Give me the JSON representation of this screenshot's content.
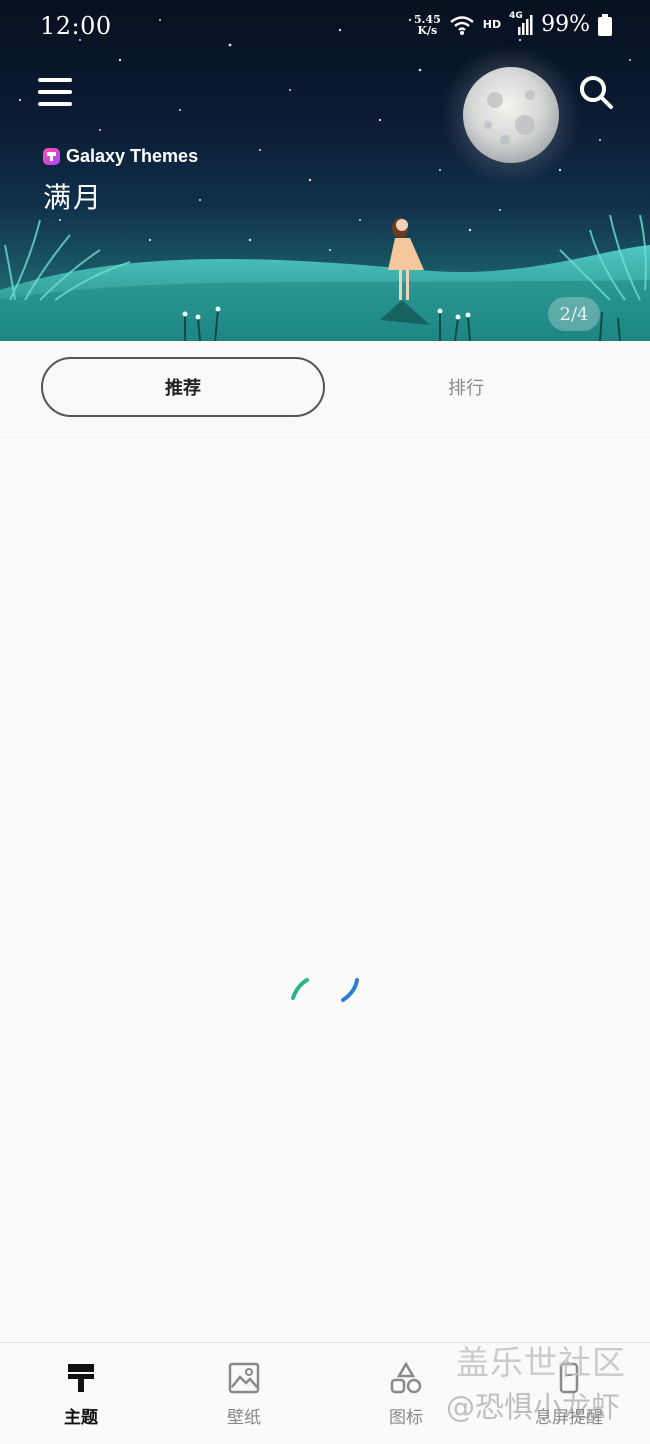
{
  "status_bar": {
    "time": "12:00",
    "net_speed_value": "5.45",
    "net_speed_unit": "K/s",
    "hd": "HD",
    "network": "4G",
    "battery": "99%"
  },
  "hero": {
    "brand": "Galaxy Themes",
    "title": "满月",
    "page_indicator": "2/4",
    "icons": [
      "menu-icon",
      "search-icon",
      "galaxy-themes-logo"
    ]
  },
  "tabs": [
    {
      "label": "推荐",
      "active": true
    },
    {
      "label": "排行",
      "active": false
    }
  ],
  "content": {
    "loading": true
  },
  "bottom_nav": [
    {
      "label": "主题",
      "icon": "paint-brush-icon",
      "active": true
    },
    {
      "label": "壁纸",
      "icon": "image-icon",
      "active": false
    },
    {
      "label": "图标",
      "icon": "shapes-icon",
      "active": false
    },
    {
      "label": "息屏提醒",
      "icon": "aod-icon",
      "active": false
    }
  ],
  "watermark": {
    "line1": "盖乐世社区",
    "line2": "@恐惧小龙虾"
  },
  "colors": {
    "spinner_green": "#2bb58a",
    "spinner_blue": "#2a7fd4",
    "active_tab_border": "#555555",
    "inactive_text": "#8a8a8a"
  }
}
